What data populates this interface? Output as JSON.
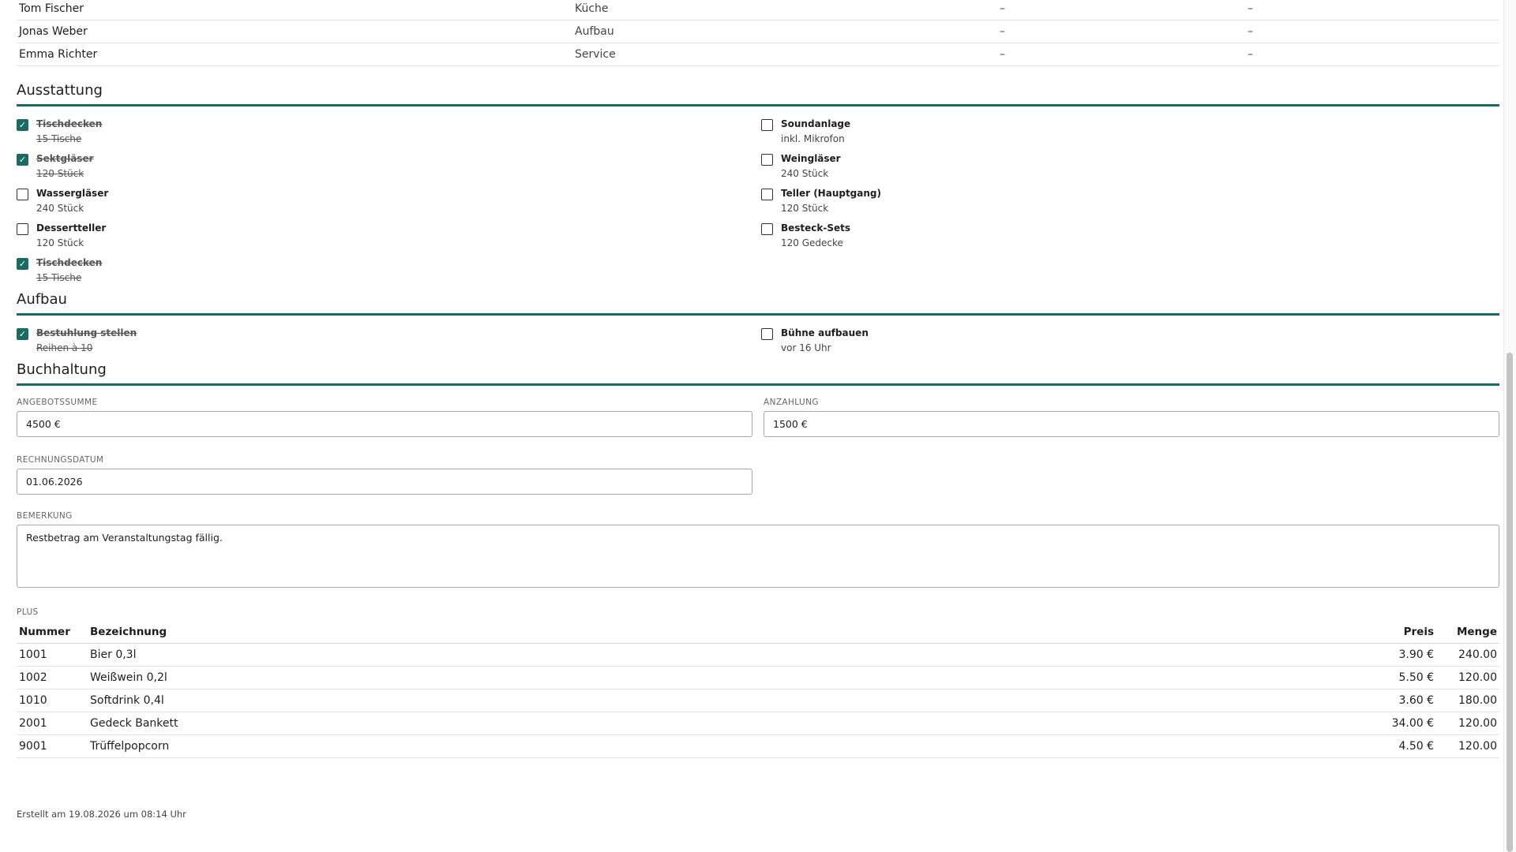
{
  "staff": [
    {
      "name": "Tom Fischer",
      "area": "Küche",
      "c3": "–",
      "c4": "–"
    },
    {
      "name": "Jonas Weber",
      "area": "Aufbau",
      "c3": "–",
      "c4": "–"
    },
    {
      "name": "Emma Richter",
      "area": "Service",
      "c3": "–",
      "c4": "–"
    }
  ],
  "ausstattung": {
    "title": "Ausstattung",
    "left": [
      {
        "label": "Tischdecken",
        "sub": "15 Tische",
        "checked": true
      },
      {
        "label": "Sektgläser",
        "sub": "120 Stück",
        "checked": true
      },
      {
        "label": "Wassergläser",
        "sub": "240 Stück",
        "checked": false
      },
      {
        "label": "Dessertteller",
        "sub": "120 Stück",
        "checked": false
      },
      {
        "label": "Tischdecken",
        "sub": "15 Tische",
        "checked": true
      }
    ],
    "right": [
      {
        "label": "Soundanlage",
        "sub": "inkl. Mikrofon",
        "checked": false
      },
      {
        "label": "Weingläser",
        "sub": "240 Stück",
        "checked": false
      },
      {
        "label": "Teller (Hauptgang)",
        "sub": "120 Stück",
        "checked": false
      },
      {
        "label": "Besteck-Sets",
        "sub": "120 Gedecke",
        "checked": false
      }
    ]
  },
  "aufbau": {
    "title": "Aufbau",
    "left": [
      {
        "label": "Bestuhlung stellen",
        "sub": "Reihen à 10",
        "checked": true
      }
    ],
    "right": [
      {
        "label": "Bühne aufbauen",
        "sub": "vor 16 Uhr",
        "checked": false
      }
    ]
  },
  "buchhaltung": {
    "title": "Buchhaltung",
    "angebotssumme_label": "ANGEBOTSSUMME",
    "angebotssumme_value": "4500 €",
    "anzahlung_label": "ANZAHLUNG",
    "anzahlung_value": "1500 €",
    "rechnungsdatum_label": "RECHNUNGSDATUM",
    "rechnungsdatum_value": "01.06.2026",
    "bemerkung_label": "BEMERKUNG",
    "bemerkung_value": "Restbetrag am Veranstaltungstag fällig."
  },
  "plu": {
    "label": "PLUS",
    "headers": {
      "nummer": "Nummer",
      "bezeichnung": "Bezeichnung",
      "preis": "Preis",
      "menge": "Menge"
    },
    "rows": [
      {
        "nummer": "1001",
        "bezeichnung": "Bier 0,3l",
        "preis": "3.90 €",
        "menge": "240.00"
      },
      {
        "nummer": "1002",
        "bezeichnung": "Weißwein 0,2l",
        "preis": "5.50 €",
        "menge": "120.00"
      },
      {
        "nummer": "1010",
        "bezeichnung": "Softdrink 0,4l",
        "preis": "3.60 €",
        "menge": "180.00"
      },
      {
        "nummer": "2001",
        "bezeichnung": "Gedeck Bankett",
        "preis": "34.00 €",
        "menge": "120.00"
      },
      {
        "nummer": "9001",
        "bezeichnung": "Trüffelpopcorn",
        "preis": "4.50 €",
        "menge": "120.00"
      }
    ]
  },
  "footer": "Erstellt am 19.08.2026 um 08:14 Uhr",
  "colors": {
    "accent": "#1a6b62",
    "border": "#a8a8a8",
    "text": "#1e1e1e"
  }
}
